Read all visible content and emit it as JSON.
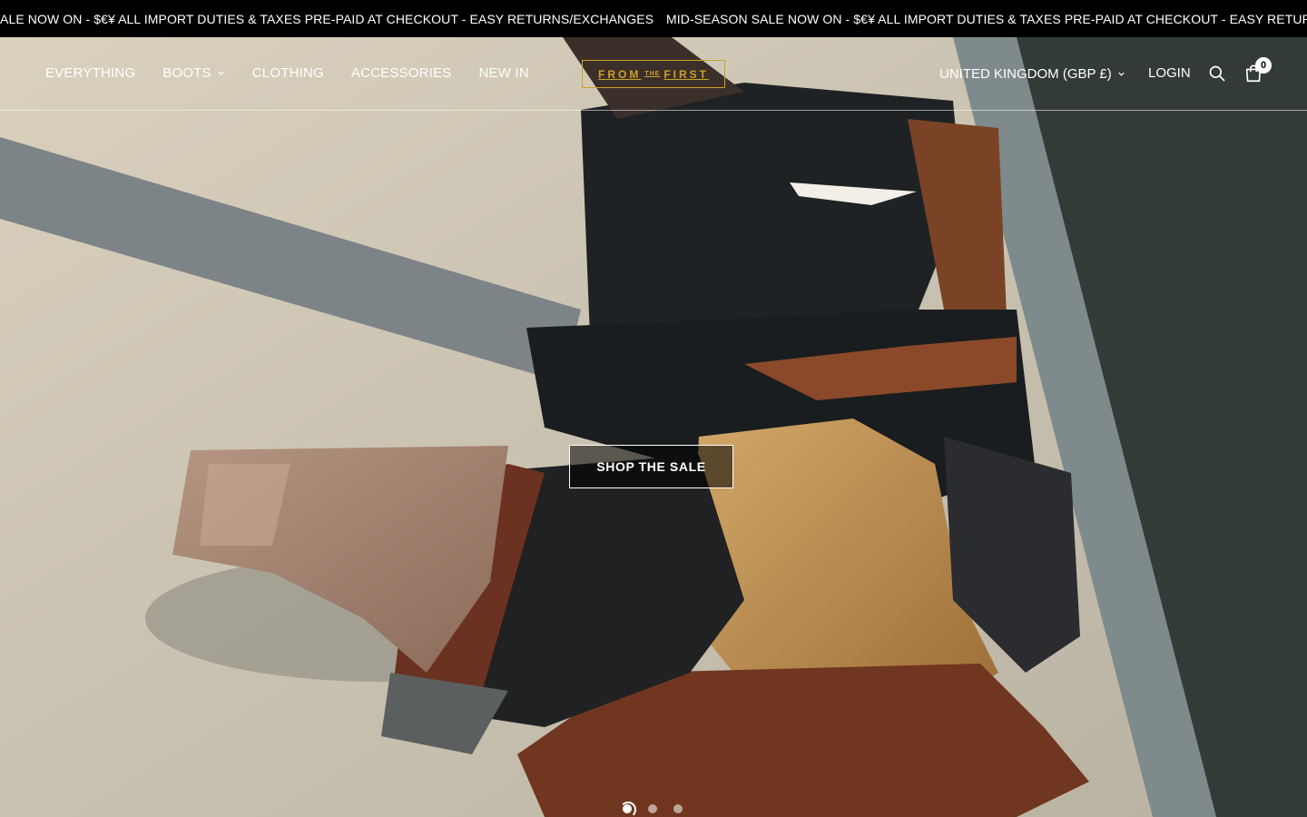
{
  "announcement": {
    "messages": [
      "ALE NOW ON - $€¥ ALL IMPORT DUTIES & TAXES PRE-PAID AT CHECKOUT - EASY RETURNS/EXCHANGES",
      "MID-SEASON SALE NOW ON - $€¥ ALL IMPORT DUTIES & TAXES PRE-PAID AT CHECKOUT - EASY RETURNS"
    ]
  },
  "nav": {
    "items": [
      {
        "label": "EVERYTHING"
      },
      {
        "label": "BOOTS"
      },
      {
        "label": "CLOTHING"
      },
      {
        "label": "ACCESSORIES"
      },
      {
        "label": "NEW IN"
      }
    ]
  },
  "logo": {
    "left": "FROM",
    "mid": "THE",
    "right": "FIRST",
    "color": "#c9a227"
  },
  "header_right": {
    "country": "UNITED KINGDOM (GBP £)",
    "login": "LOGIN",
    "cart_count": "0"
  },
  "hero": {
    "cta_label": "SHOP THE SALE",
    "slide_count": 3,
    "active_slide": 1
  },
  "icons": {
    "search": "search-icon",
    "cart": "cart-icon",
    "chevron": "chevron-down-icon"
  }
}
